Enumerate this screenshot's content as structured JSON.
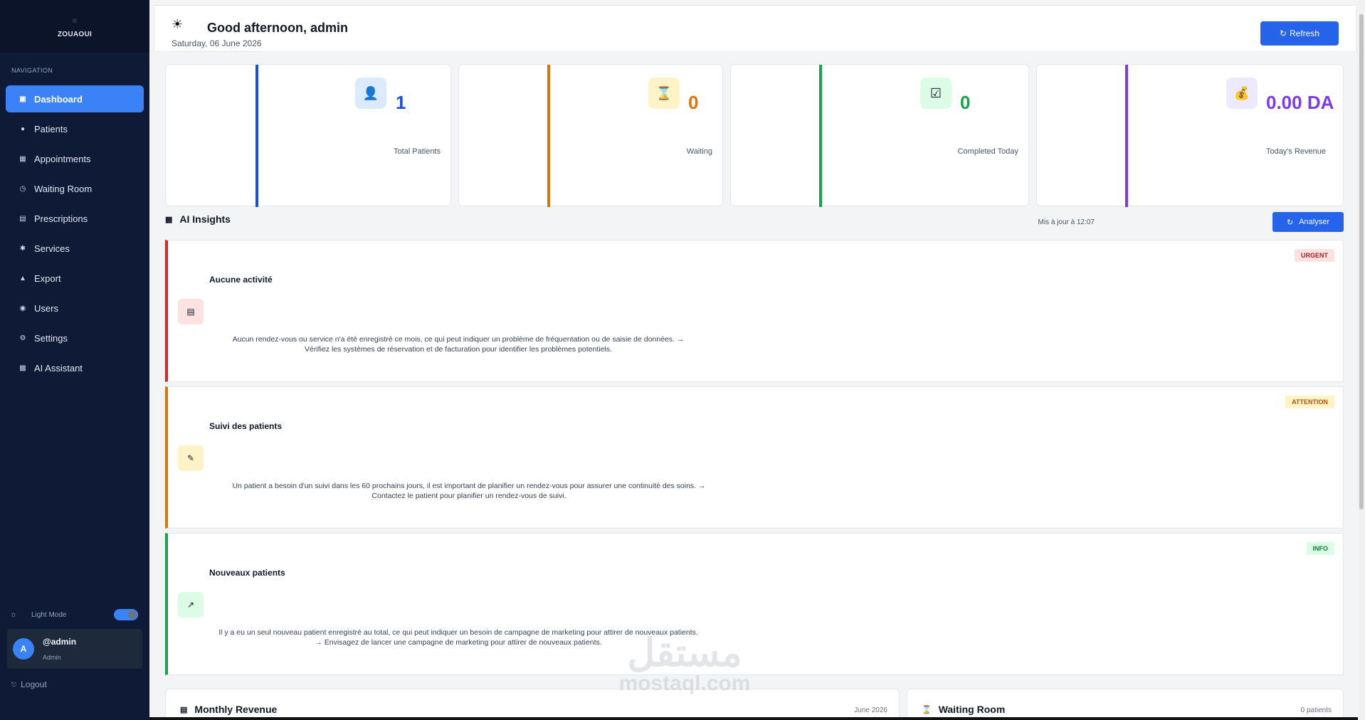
{
  "brand": {
    "name": "ZOUAOUI"
  },
  "sidebar": {
    "heading": "NAVIGATION",
    "items": [
      {
        "label": "Dashboard",
        "icon": "dashboard-icon",
        "active": true
      },
      {
        "label": "Patients",
        "icon": "person-icon"
      },
      {
        "label": "Appointments",
        "icon": "calendar-icon"
      },
      {
        "label": "Waiting Room",
        "icon": "clock-icon"
      },
      {
        "label": "Prescriptions",
        "icon": "prescription-icon"
      },
      {
        "label": "Services",
        "icon": "services-icon"
      },
      {
        "label": "Export",
        "icon": "export-icon"
      },
      {
        "label": "Users",
        "icon": "users-icon"
      },
      {
        "label": "Settings",
        "icon": "gear-icon"
      },
      {
        "label": "AI Assistant",
        "icon": "robot-icon"
      }
    ],
    "mode_label": "Light Mode",
    "user": {
      "initial": "A",
      "name": "@admin",
      "role": "Admin"
    },
    "logout_label": "Logout"
  },
  "header": {
    "greeting": "Good afternoon, admin",
    "date": "Saturday, 06 June 2026",
    "refresh_label": "Refresh"
  },
  "stats": [
    {
      "value": "1",
      "label": "Total Patients",
      "color": "#1d4ed8",
      "icon": "person-icon"
    },
    {
      "value": "0",
      "label": "Waiting",
      "color": "#d97706",
      "icon": "hourglass-icon"
    },
    {
      "value": "0",
      "label": "Completed Today",
      "color": "#16a34a",
      "icon": "check-icon"
    },
    {
      "value": "0.00 DA",
      "label": "Today's Revenue",
      "color": "#7c3aed",
      "icon": "money-bag-icon"
    }
  ],
  "ai": {
    "title": "AI Insights",
    "updated": "Mis à jour à 12:07",
    "analyse_label": "Analyser",
    "insights": [
      {
        "badge": "URGENT",
        "title": "Aucune activité",
        "line1": "Aucun rendez-vous ou service n'a été enregistré ce mois, ce qui peut indiquer un problème de fréquentation ou de saisie de données. →",
        "line2": "Vérifiez les systèmes de réservation et de facturation pour identifier les problèmes potentiels.",
        "color": "#dc2626",
        "icon": "bar-chart-icon"
      },
      {
        "badge": "ATTENTION",
        "title": "Suivi des patients",
        "line1": "Un patient a besoin d'un suivi dans les 60 prochains jours, il est important de planifier un rendez-vous pour assurer une continuité des soins. →",
        "line2": "Contactez le patient pour planifier un rendez-vous de suivi.",
        "color": "#d97706",
        "icon": "memo-icon"
      },
      {
        "badge": "INFO",
        "title": "Nouveaux patients",
        "line1": "Il y a eu un seul nouveau patient enregistré au total, ce qui peut indiquer un besoin de campagne de marketing pour attirer de nouveaux patients.",
        "line2": "→ Envisagez de lancer une campagne de marketing pour attirer de nouveaux patients.",
        "color": "#16a34a",
        "icon": "trend-chart-icon"
      }
    ]
  },
  "bottom": {
    "revenue_title": "Monthly Revenue",
    "revenue_meta": "June 2026",
    "waiting_title": "Waiting Room",
    "waiting_meta": "0 patients"
  },
  "watermark": {
    "arabic": "مستقل",
    "latin": "mostaql.com"
  }
}
